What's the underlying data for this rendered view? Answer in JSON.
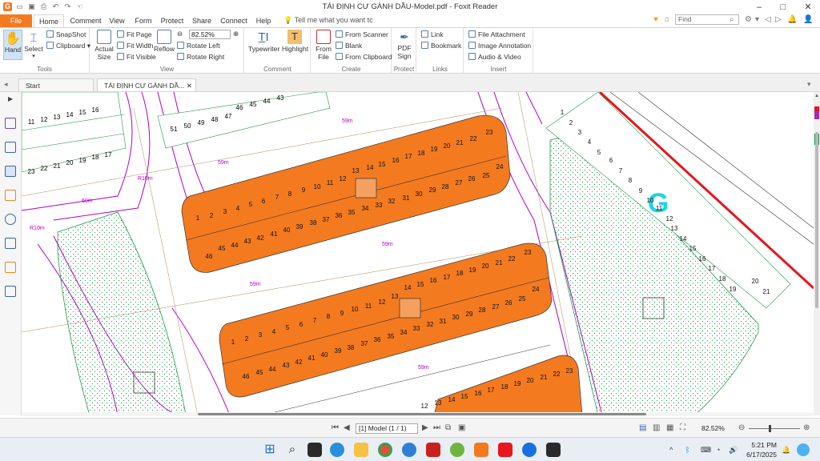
{
  "window": {
    "title": "TÁI ĐỊNH CƯ GÀNH DẦU-Model.pdf - Foxit Reader"
  },
  "menu": {
    "tabs": [
      "File",
      "Home",
      "Comment",
      "View",
      "Form",
      "Protect",
      "Share",
      "Connect",
      "Help"
    ],
    "tell_me": "Tell me what you want tc",
    "find_placeholder": "Find"
  },
  "ribbon": {
    "tools": {
      "label": "Tools",
      "hand": "Hand",
      "select": "Select",
      "snapshot": "SnapShot",
      "clipboard": "Clipboard"
    },
    "view": {
      "label": "View",
      "actual_size_1": "Actual",
      "actual_size_2": "Size",
      "fit_page": "Fit Page",
      "fit_width": "Fit Width",
      "fit_visible": "Fit Visible",
      "reflow": "Reflow",
      "zoom": "82.52%",
      "rotate_left": "Rotate Left",
      "rotate_right": "Rotate Right"
    },
    "comment": {
      "label": "Comment",
      "typewriter": "Typewriter",
      "highlight": "Highlight"
    },
    "create": {
      "label": "Create",
      "from_file_1": "From",
      "from_file_2": "File",
      "from_scanner": "From Scanner",
      "blank": "Blank",
      "from_clipboard": "From Clipboard"
    },
    "protect": {
      "label": "Protect",
      "pdf_sign_1": "PDF",
      "pdf_sign_2": "Sign"
    },
    "links": {
      "label": "Links",
      "link": "Link",
      "bookmark": "Bookmark"
    },
    "insert": {
      "label": "Insert",
      "file_attachment": "File Attachment",
      "image_annotation": "Image Annotation",
      "audio_video": "Audio & Video"
    }
  },
  "doc_tabs": {
    "start": "Start",
    "document": "TÁI ĐỊNH CƯ GÀNH DẦ..."
  },
  "drawing": {
    "block_letter": "G",
    "dim_59m": "59m",
    "dim_60m": "60m",
    "dim_r10m": "R10m",
    "upper_row_a": [
      "13",
      "14",
      "15",
      "16",
      "17",
      "18",
      "19",
      "20",
      "21",
      "22",
      "23"
    ],
    "upper_row_b": [
      "1",
      "2",
      "3",
      "4",
      "5",
      "6",
      "7",
      "8",
      "9",
      "10",
      "11",
      "12"
    ],
    "upper_row_c": [
      "45",
      "44",
      "43",
      "42",
      "41",
      "40",
      "39",
      "38",
      "37",
      "36",
      "35",
      "34",
      "33",
      "32",
      "31",
      "30",
      "29",
      "28",
      "27",
      "26",
      "25",
      "24"
    ],
    "mid_row_b": [
      "1",
      "2",
      "3",
      "4",
      "5",
      "6",
      "7",
      "8",
      "9",
      "10",
      "11",
      "12",
      "13",
      "14",
      "15",
      "16",
      "17",
      "18",
      "19",
      "20",
      "21",
      "22",
      "23"
    ],
    "mid_row_c": [
      "46",
      "45",
      "44",
      "43",
      "42",
      "41",
      "40",
      "39",
      "38",
      "37",
      "36",
      "35",
      "34",
      "33",
      "32",
      "31",
      "30",
      "29",
      "28",
      "27",
      "26",
      "25",
      "24"
    ],
    "bottom_row": [
      "12",
      "13",
      "14",
      "15",
      "16",
      "17",
      "18",
      "19",
      "20",
      "21",
      "22",
      "23"
    ],
    "right_lots": [
      "1",
      "2",
      "3",
      "4",
      "5",
      "6",
      "7",
      "8",
      "9",
      "10",
      "11",
      "12",
      "13",
      "14",
      "15",
      "16",
      "17",
      "18",
      "19",
      "20",
      "21"
    ],
    "top_left_lots": [
      "11",
      "12",
      "13",
      "14",
      "15",
      "16",
      "23",
      "22",
      "21",
      "20",
      "19",
      "18",
      "17"
    ],
    "top_mid_lots": [
      "51",
      "50",
      "49",
      "48",
      "47",
      "46",
      "45",
      "44",
      "43"
    ],
    "upper_first": "1",
    "upper_last_c": "46"
  },
  "status": {
    "page": "[1] Model (1 / 1)",
    "zoom": "82.52%"
  },
  "taskbar": {
    "time": "5:21 PM",
    "date": "6/17/2025"
  },
  "colors": {
    "accent": "#f47a20",
    "lot_fill": "#f47a20",
    "road_line": "#b000c8",
    "highlight_line": "#e8141e",
    "green_hatch": "#1f9a4a"
  }
}
